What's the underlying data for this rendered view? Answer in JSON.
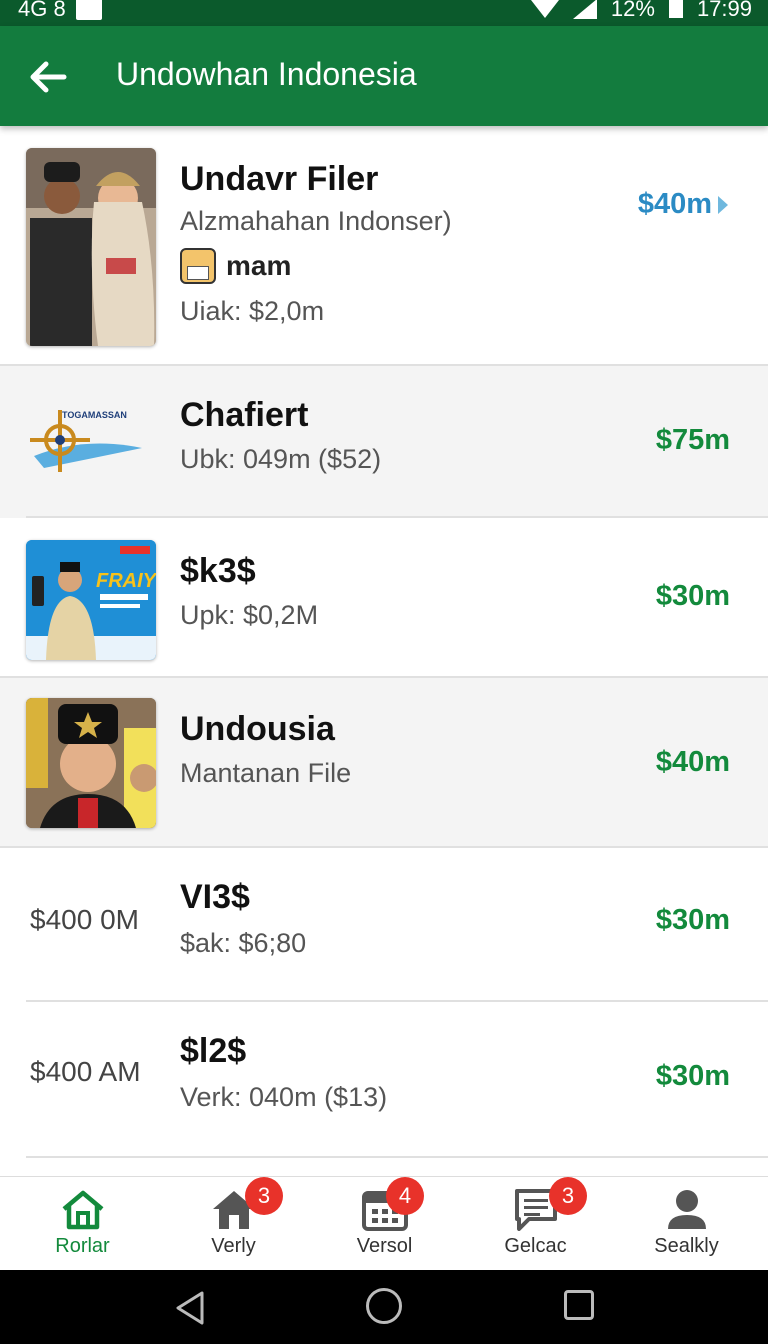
{
  "status_bar": {
    "left_text": "4G 8",
    "battery": "12%",
    "time": "17:99"
  },
  "app_bar": {
    "title": "Undowhan Indonesia",
    "back_icon": "arrow-left-icon"
  },
  "list": [
    {
      "title": "Undavr Filer",
      "subtitle": "Alzmahahan Indonser)",
      "tag": "mam",
      "detail": "Uiak: $2,0m",
      "price": "$40m",
      "price_color": "#2b8bc4",
      "thumb": "photo-couple"
    },
    {
      "title": "Chafiert",
      "subtitle": "Ubk: 049m  ($52)",
      "price": "$75m",
      "price_color": "#138a3c",
      "thumb": "logo-ship-wheel",
      "logo_text": "TOGAMASSAN"
    },
    {
      "title": "$k3$",
      "subtitle": "Upk: $0,2M",
      "price": "$30m",
      "price_color": "#138a3c",
      "thumb": "poster-fraiy",
      "poster_text": "FRAIY"
    },
    {
      "title": "Undousia",
      "subtitle": "Mantanan File",
      "price": "$40m",
      "price_color": "#138a3c",
      "thumb": "photo-man-hat"
    },
    {
      "leading": "$400 0M",
      "title": "VI3$",
      "subtitle": "$ak: $6;80",
      "price": "$30m",
      "price_color": "#138a3c"
    },
    {
      "leading": "$400 AM",
      "title": "$l2$",
      "subtitle": "Verk: 040m  ($13)",
      "price": "$30m",
      "price_color": "#138a3c"
    }
  ],
  "bottom_nav": [
    {
      "label": "Rorlar",
      "icon": "home-icon",
      "active": true
    },
    {
      "label": "Verly",
      "icon": "home-filled-icon",
      "badge": "3"
    },
    {
      "label": "Versol",
      "icon": "calendar-icon",
      "badge": "4"
    },
    {
      "label": "Gelcac",
      "icon": "message-icon",
      "badge": "3"
    },
    {
      "label": "Sealkly",
      "icon": "person-icon"
    }
  ],
  "colors": {
    "primary": "#137c3e",
    "status_bar": "#0b5a2c",
    "price_green": "#138a3c",
    "price_blue": "#2b8bc4",
    "badge": "#e8322a"
  }
}
